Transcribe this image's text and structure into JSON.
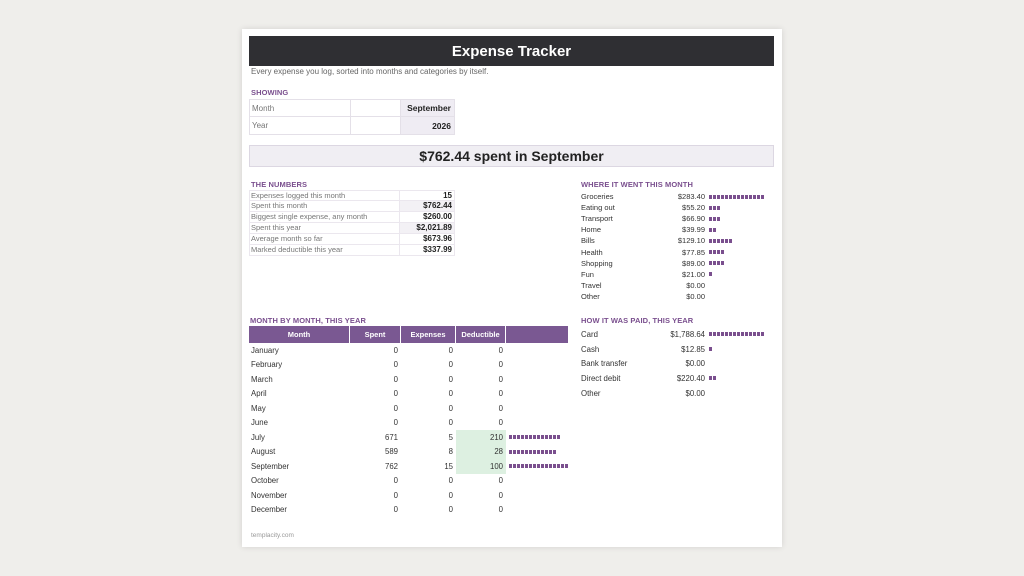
{
  "title": "Expense Tracker",
  "subtitle": "Every expense you log, sorted into months and categories by itself.",
  "showing": {
    "heading": "SHOWING",
    "rows": [
      {
        "label": "Month",
        "value": "September"
      },
      {
        "label": "Year",
        "value": "2026"
      }
    ]
  },
  "banner": "$762.44 spent in September",
  "numbers": {
    "heading": "THE NUMBERS",
    "rows": [
      {
        "label": "Expenses logged this month",
        "value": "15",
        "shade": false
      },
      {
        "label": "Spent this month",
        "value": "$762.44",
        "shade": true
      },
      {
        "label": "Biggest single expense, any month",
        "value": "$260.00",
        "shade": false
      },
      {
        "label": "Spent this year",
        "value": "$2,021.89",
        "shade": true
      },
      {
        "label": "Average month so far",
        "value": "$673.96",
        "shade": false
      },
      {
        "label": "Marked deductible this year",
        "value": "$337.99",
        "shade": false
      }
    ]
  },
  "categories": {
    "heading": "WHERE IT WENT THIS MONTH",
    "rows": [
      {
        "name": "Groceries",
        "amount": "$283.40",
        "bar": 14
      },
      {
        "name": "Eating out",
        "amount": "$55.20",
        "bar": 3
      },
      {
        "name": "Transport",
        "amount": "$66.90",
        "bar": 3
      },
      {
        "name": "Home",
        "amount": "$39.99",
        "bar": 2
      },
      {
        "name": "Bills",
        "amount": "$129.10",
        "bar": 6
      },
      {
        "name": "Health",
        "amount": "$77.85",
        "bar": 4
      },
      {
        "name": "Shopping",
        "amount": "$89.00",
        "bar": 4
      },
      {
        "name": "Fun",
        "amount": "$21.00",
        "bar": 1
      },
      {
        "name": "Travel",
        "amount": "$0.00",
        "bar": 0
      },
      {
        "name": "Other",
        "amount": "$0.00",
        "bar": 0
      }
    ]
  },
  "months": {
    "heading": "MONTH BY MONTH, THIS YEAR",
    "columns": [
      "Month",
      "Spent",
      "Expenses",
      "Deductible"
    ],
    "rows": [
      {
        "month": "January",
        "spent": "0",
        "expenses": "0",
        "deductible": "0",
        "highlight": false,
        "bar": 0
      },
      {
        "month": "February",
        "spent": "0",
        "expenses": "0",
        "deductible": "0",
        "highlight": false,
        "bar": 0
      },
      {
        "month": "March",
        "spent": "0",
        "expenses": "0",
        "deductible": "0",
        "highlight": false,
        "bar": 0
      },
      {
        "month": "April",
        "spent": "0",
        "expenses": "0",
        "deductible": "0",
        "highlight": false,
        "bar": 0
      },
      {
        "month": "May",
        "spent": "0",
        "expenses": "0",
        "deductible": "0",
        "highlight": false,
        "bar": 0
      },
      {
        "month": "June",
        "spent": "0",
        "expenses": "0",
        "deductible": "0",
        "highlight": false,
        "bar": 0
      },
      {
        "month": "July",
        "spent": "671",
        "expenses": "5",
        "deductible": "210",
        "highlight": true,
        "bar": 13
      },
      {
        "month": "August",
        "spent": "589",
        "expenses": "8",
        "deductible": "28",
        "highlight": true,
        "bar": 12
      },
      {
        "month": "September",
        "spent": "762",
        "expenses": "15",
        "deductible": "100",
        "highlight": true,
        "bar": 15
      },
      {
        "month": "October",
        "spent": "0",
        "expenses": "0",
        "deductible": "0",
        "highlight": false,
        "bar": 0
      },
      {
        "month": "November",
        "spent": "0",
        "expenses": "0",
        "deductible": "0",
        "highlight": false,
        "bar": 0
      },
      {
        "month": "December",
        "spent": "0",
        "expenses": "0",
        "deductible": "0",
        "highlight": false,
        "bar": 0
      }
    ]
  },
  "payment": {
    "heading": "HOW IT WAS PAID, THIS YEAR",
    "rows": [
      {
        "name": "Card",
        "amount": "$1,788.64",
        "bar": 14
      },
      {
        "name": "Cash",
        "amount": "$12.85",
        "bar": 1
      },
      {
        "name": "Bank transfer",
        "amount": "$0.00",
        "bar": 0
      },
      {
        "name": "Direct debit",
        "amount": "$220.40",
        "bar": 2
      },
      {
        "name": "Other",
        "amount": "$0.00",
        "bar": 0
      }
    ]
  },
  "footer": "templacity.com",
  "colors": {
    "accent": "#7a4f8e",
    "header_bg": "#2f2f33",
    "highlight": "#ddf0e1"
  }
}
